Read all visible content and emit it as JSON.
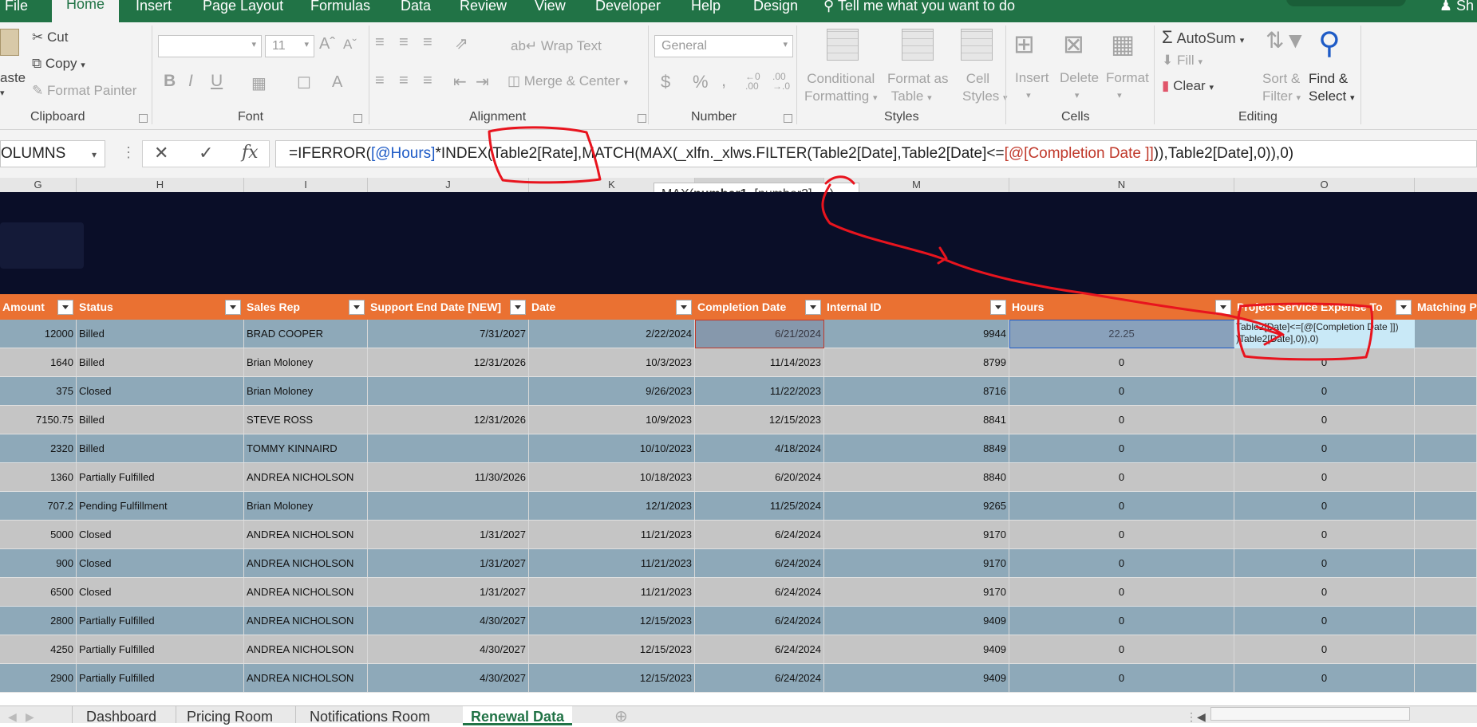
{
  "menu": {
    "tabs": [
      "File",
      "Home",
      "Insert",
      "Page Layout",
      "Formulas",
      "Data",
      "Review",
      "View",
      "Developer",
      "Help",
      "Design"
    ],
    "active": "Home",
    "tell_me": "Tell me what you want to do",
    "share": "Sh"
  },
  "ribbon": {
    "clipboard": {
      "paste": "aste",
      "cut": "Cut",
      "copy": "Copy",
      "format_painter": "Format Painter",
      "label": "Clipboard"
    },
    "font": {
      "font_name": "",
      "font_size": "11",
      "bold": "B",
      "italic": "I",
      "underline": "U",
      "label": "Font"
    },
    "alignment": {
      "wrap_text": "Wrap Text",
      "merge_center": "Merge & Center",
      "label": "Alignment"
    },
    "number": {
      "format": "General",
      "currency": "$",
      "percent": "%",
      "comma": ",",
      "label": "Number"
    },
    "styles": {
      "conditional_formatting": [
        "Conditional",
        "Formatting"
      ],
      "format_as_table": [
        "Format as",
        "Table"
      ],
      "cell_styles": [
        "Cell",
        "Styles"
      ],
      "label": "Styles"
    },
    "cells": {
      "insert": "Insert",
      "delete": "Delete",
      "format": "Format",
      "label": "Cells"
    },
    "editing": {
      "autosum": "AutoSum",
      "fill": "Fill",
      "clear": "Clear",
      "sort_filter": [
        "Sort &",
        "Filter"
      ],
      "find_select": [
        "Find &",
        "Select"
      ],
      "label": "Editing"
    }
  },
  "formula_bar": {
    "name_box": "OLUMNS",
    "fx": "fx",
    "formula_parts": [
      {
        "text": "=IFERROR(",
        "style": "plain"
      },
      {
        "text": "[@Hours]",
        "style": "ref1"
      },
      {
        "text": "*INDEX(Table2[Rate],MATCH(MAX(_xlfn._xlws.FILTER(Table2[Date],Table2[Date]<=",
        "style": "plain"
      },
      {
        "text": "[@[Completion Date ]]",
        "style": "ref2"
      },
      {
        "text": ")),Table2[Date],0)),0)",
        "style": "plain"
      }
    ]
  },
  "tooltip": {
    "fn": "MAX(",
    "arg1": "number1",
    "rest": ", [number2], ...)"
  },
  "columns": [
    "G",
    "H",
    "I",
    "J",
    "K",
    "L",
    "M",
    "N",
    "O"
  ],
  "table": {
    "headers": [
      "Amount",
      "Status",
      "Sales Rep",
      "Support End Date [NEW]",
      "Date",
      "Completion Date",
      "Internal ID",
      "Hours",
      "Project Service  Expense To",
      "Matching P"
    ],
    "rows": [
      [
        "12000",
        "Billed",
        "BRAD  COOPER",
        "7/31/2027",
        "2/22/2024",
        "6/21/2024",
        "9944",
        "22.25",
        "",
        ""
      ],
      [
        "1640",
        "Billed",
        "Brian Moloney",
        "12/31/2026",
        "10/3/2023",
        "11/14/2023",
        "8799",
        "0",
        "0",
        ""
      ],
      [
        "375",
        "Closed",
        "Brian Moloney",
        "",
        "9/26/2023",
        "11/22/2023",
        "8716",
        "0",
        "0",
        ""
      ],
      [
        "7150.75",
        "Billed",
        "STEVE ROSS",
        "12/31/2026",
        "10/9/2023",
        "12/15/2023",
        "8841",
        "0",
        "0",
        ""
      ],
      [
        "2320",
        "Billed",
        "TOMMY  KINNAIRD",
        "",
        "10/10/2023",
        "4/18/2024",
        "8849",
        "0",
        "0",
        ""
      ],
      [
        "1360",
        "Partially Fulfilled",
        "ANDREA  NICHOLSON",
        "11/30/2026",
        "10/18/2023",
        "6/20/2024",
        "8840",
        "0",
        "0",
        ""
      ],
      [
        "707.2",
        "Pending Fulfillment",
        "Brian Moloney",
        "",
        "12/1/2023",
        "11/25/2024",
        "9265",
        "0",
        "0",
        ""
      ],
      [
        "5000",
        "Closed",
        "ANDREA  NICHOLSON",
        "1/31/2027",
        "11/21/2023",
        "6/24/2024",
        "9170",
        "0",
        "0",
        ""
      ],
      [
        "900",
        "Closed",
        "ANDREA  NICHOLSON",
        "1/31/2027",
        "11/21/2023",
        "6/24/2024",
        "9170",
        "0",
        "0",
        ""
      ],
      [
        "6500",
        "Closed",
        "ANDREA  NICHOLSON",
        "1/31/2027",
        "11/21/2023",
        "6/24/2024",
        "9170",
        "0",
        "0",
        ""
      ],
      [
        "2800",
        "Partially Fulfilled",
        "ANDREA  NICHOLSON",
        "4/30/2027",
        "12/15/2023",
        "6/24/2024",
        "9409",
        "0",
        "0",
        ""
      ],
      [
        "4250",
        "Partially Fulfilled",
        "ANDREA  NICHOLSON",
        "4/30/2027",
        "12/15/2023",
        "6/24/2024",
        "9409",
        "0",
        "0",
        ""
      ],
      [
        "2900",
        "Partially Fulfilled",
        "ANDREA  NICHOLSON",
        "4/30/2027",
        "12/15/2023",
        "6/24/2024",
        "9409",
        "0",
        "0",
        ""
      ]
    ],
    "edit_cell_lines": [
      "Table2[Date]<=[@[Completion Date ]])",
      ")Table2[Date],0)),0)"
    ]
  },
  "sheet_tabs": [
    "Dashboard",
    "Pricing Room",
    "Notifications Room",
    "Renewal Data"
  ],
  "active_sheet": "Renewal Data",
  "colors": {
    "excel_green": "#217346",
    "header_orange": "#ea7132",
    "banner_navy": "#0a0e28",
    "band_blue": "#8ea9b9",
    "band_gray": "#c5c5c5",
    "ink_red": "#e8141e"
  }
}
